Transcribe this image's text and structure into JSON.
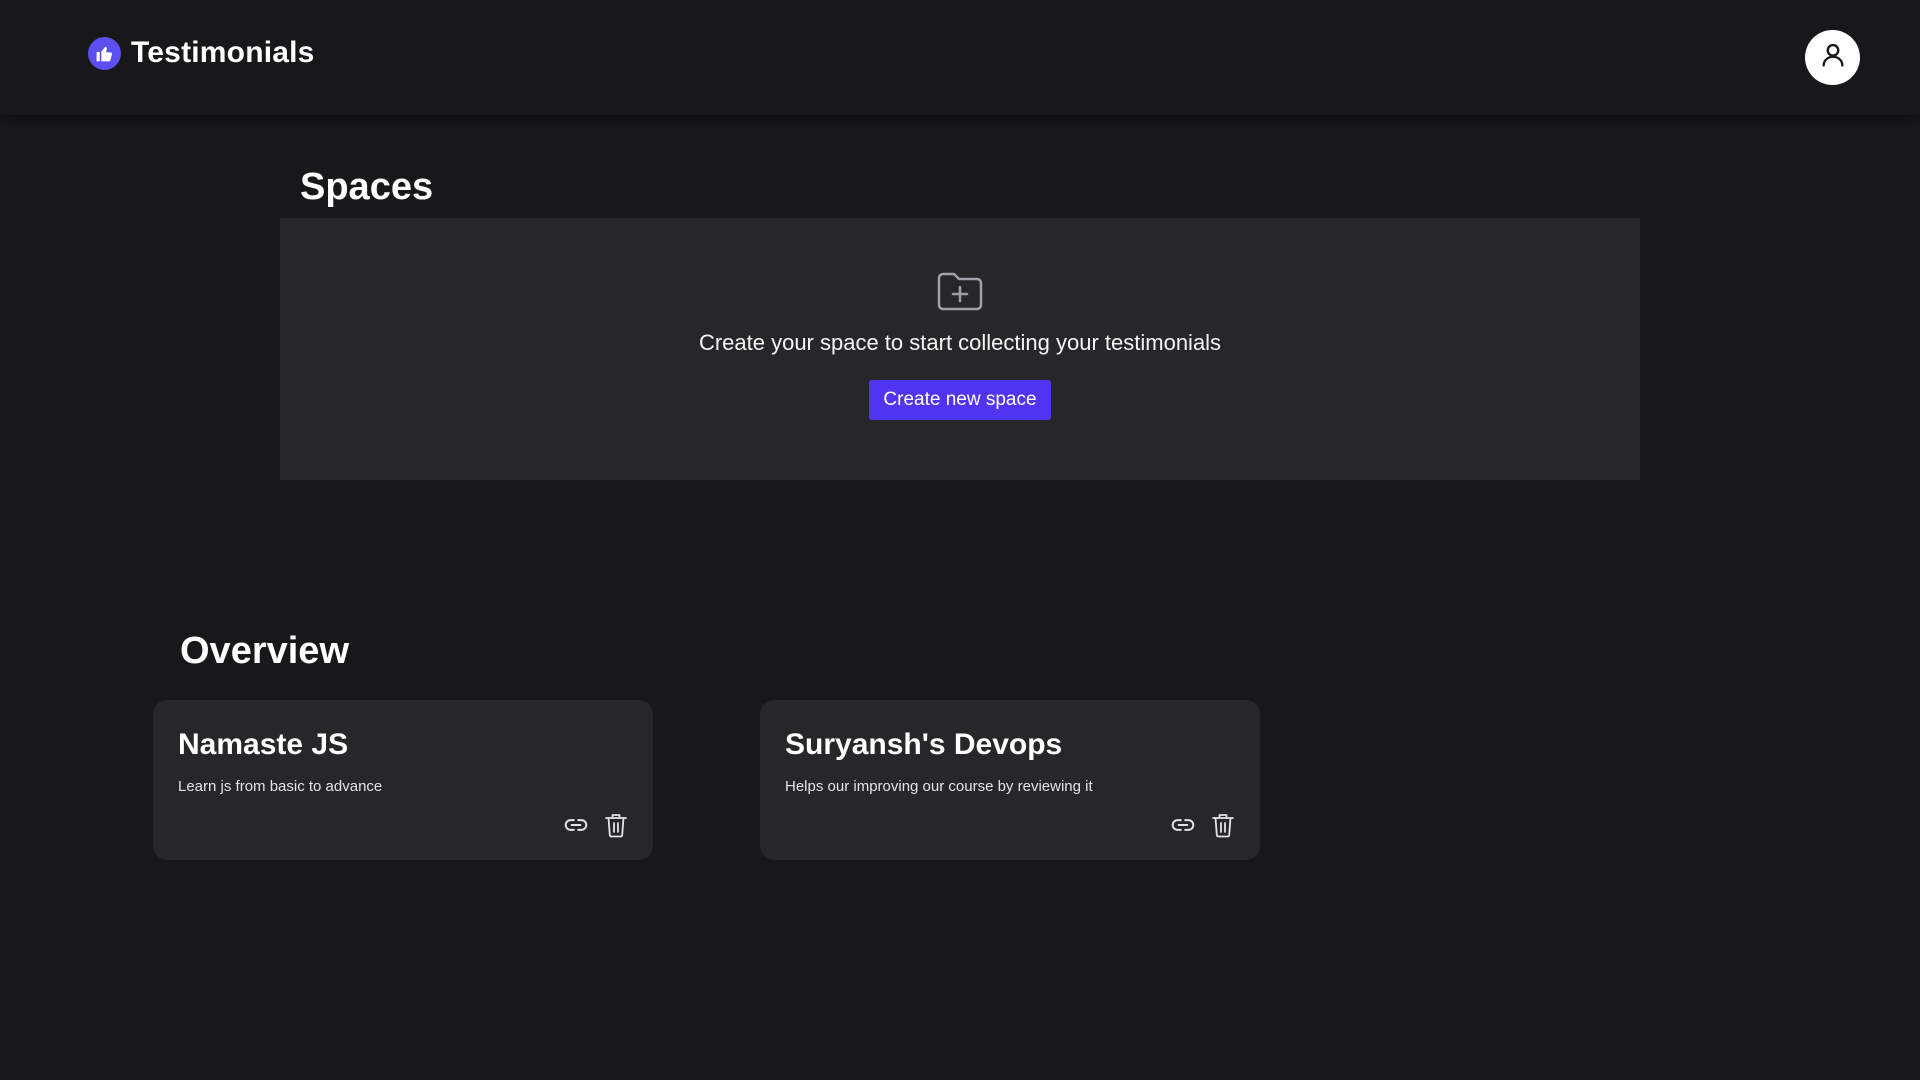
{
  "header": {
    "brand_title": "Testimonials",
    "brand_icon": "thumbs-up-icon",
    "avatar_icon": "user-icon",
    "accent_color": "#5b4ff0"
  },
  "spaces": {
    "title": "Spaces",
    "empty_icon": "folder-plus-icon",
    "empty_message": "Create your space to start collecting your testimonials",
    "create_button_label": "Create new space",
    "button_color": "#4f35f2"
  },
  "overview": {
    "title": "Overview",
    "cards": [
      {
        "title": "Namaste JS",
        "description": "Learn js from basic to advance",
        "actions": [
          "link-icon",
          "trash-icon"
        ]
      },
      {
        "title": "Suryansh's Devops",
        "description": "Helps our improving our course by reviewing it",
        "actions": [
          "link-icon",
          "trash-icon"
        ]
      }
    ]
  }
}
